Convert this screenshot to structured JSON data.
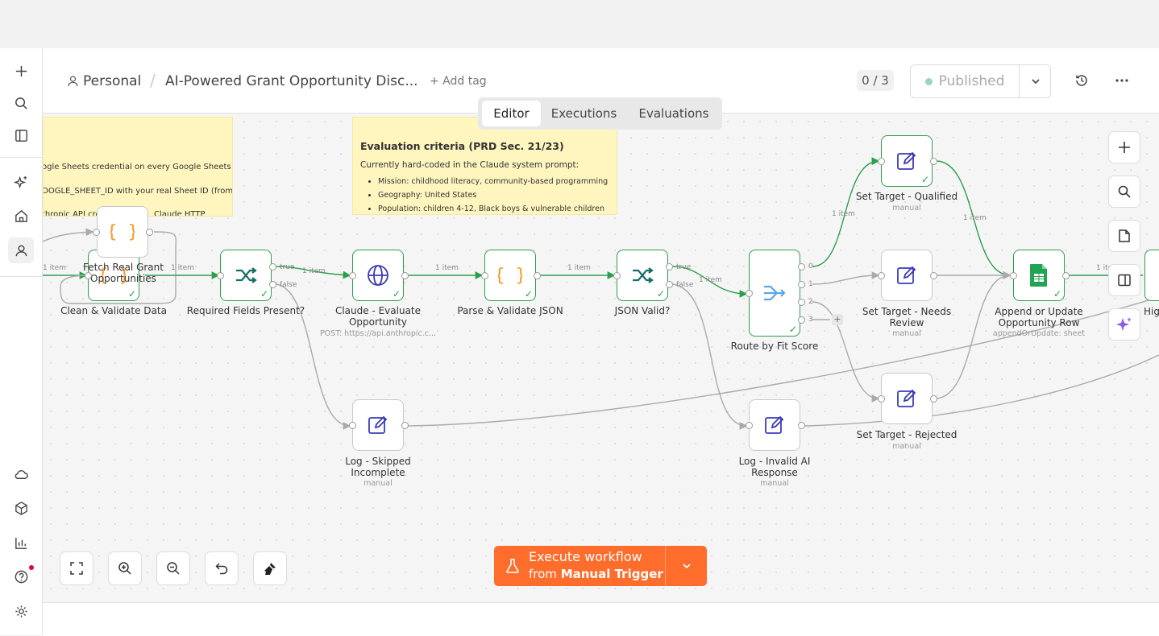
{
  "breadcrumb": {
    "project": "Personal",
    "workflow_name": "AI-Powered Grant Opportunity Disc...",
    "add_tag": "+ Add tag"
  },
  "header": {
    "count": "0 / 3",
    "status": "Published"
  },
  "tabs": {
    "editor": "Editor",
    "executions": "Executions",
    "evaluations": "Evaluations",
    "active": "Editor"
  },
  "sticky_setup": {
    "line1": "ogle Sheets credential on every Google Sheets",
    "line2": "OOGLE_SHEET_ID with your real Sheet ID (from",
    "line3": "thropic API cred",
    "line3b": "Claude HTTP"
  },
  "sticky_eval": {
    "title": "Evaluation criteria (PRD Sec. 21/23)",
    "intro": "Currently hard-coded in the Claude system prompt:",
    "items": [
      "Mission: childhood literacy, community-based programming",
      "Geography: United States",
      "Population: children 4-12, Black boys & vulnerable children"
    ]
  },
  "nodes": {
    "fetch": {
      "label": "Fetch Real Grant Opportunities"
    },
    "clean": {
      "label": "Clean & Validate Data"
    },
    "required": {
      "label": "Required Fields Present?"
    },
    "claude": {
      "label": "Claude - Evaluate Opportunity",
      "sub": "POST: https://api.anthropic.c..."
    },
    "parse": {
      "label": "Parse & Validate JSON"
    },
    "json_valid": {
      "label": "JSON Valid?"
    },
    "route": {
      "label": "Route by Fit Score"
    },
    "qualified": {
      "label": "Set Target - Qualified",
      "sub": "manual"
    },
    "needs_review": {
      "label": "Set Target - Needs Review",
      "sub": "manual"
    },
    "rejected": {
      "label": "Set Target - Rejected",
      "sub": "manual"
    },
    "append": {
      "label": "Append or Update Opportunity Row",
      "sub": "appendOrUpdate: sheet"
    },
    "log_skipped": {
      "label": "Log - Skipped Incomplete",
      "sub": "manual"
    },
    "log_invalid": {
      "label": "Log - Invalid AI Response",
      "sub": "manual"
    },
    "next": {
      "label": "Hig"
    }
  },
  "edges": {
    "item": "1 item",
    "true": "true",
    "false": "false",
    "out0": "0",
    "out1": "1",
    "out2": "2",
    "out3": "3",
    "plus": "+"
  },
  "execute": {
    "line1": "Execute workflow",
    "line2_prefix": "from",
    "line2_trigger": "Manual Trigger"
  },
  "colors": {
    "accent": "#ff6d2d",
    "success": "#29a14a",
    "node_border": "#2e9e4c",
    "sticky": "#fff6bf",
    "published_dot": "#9ad3c4"
  }
}
